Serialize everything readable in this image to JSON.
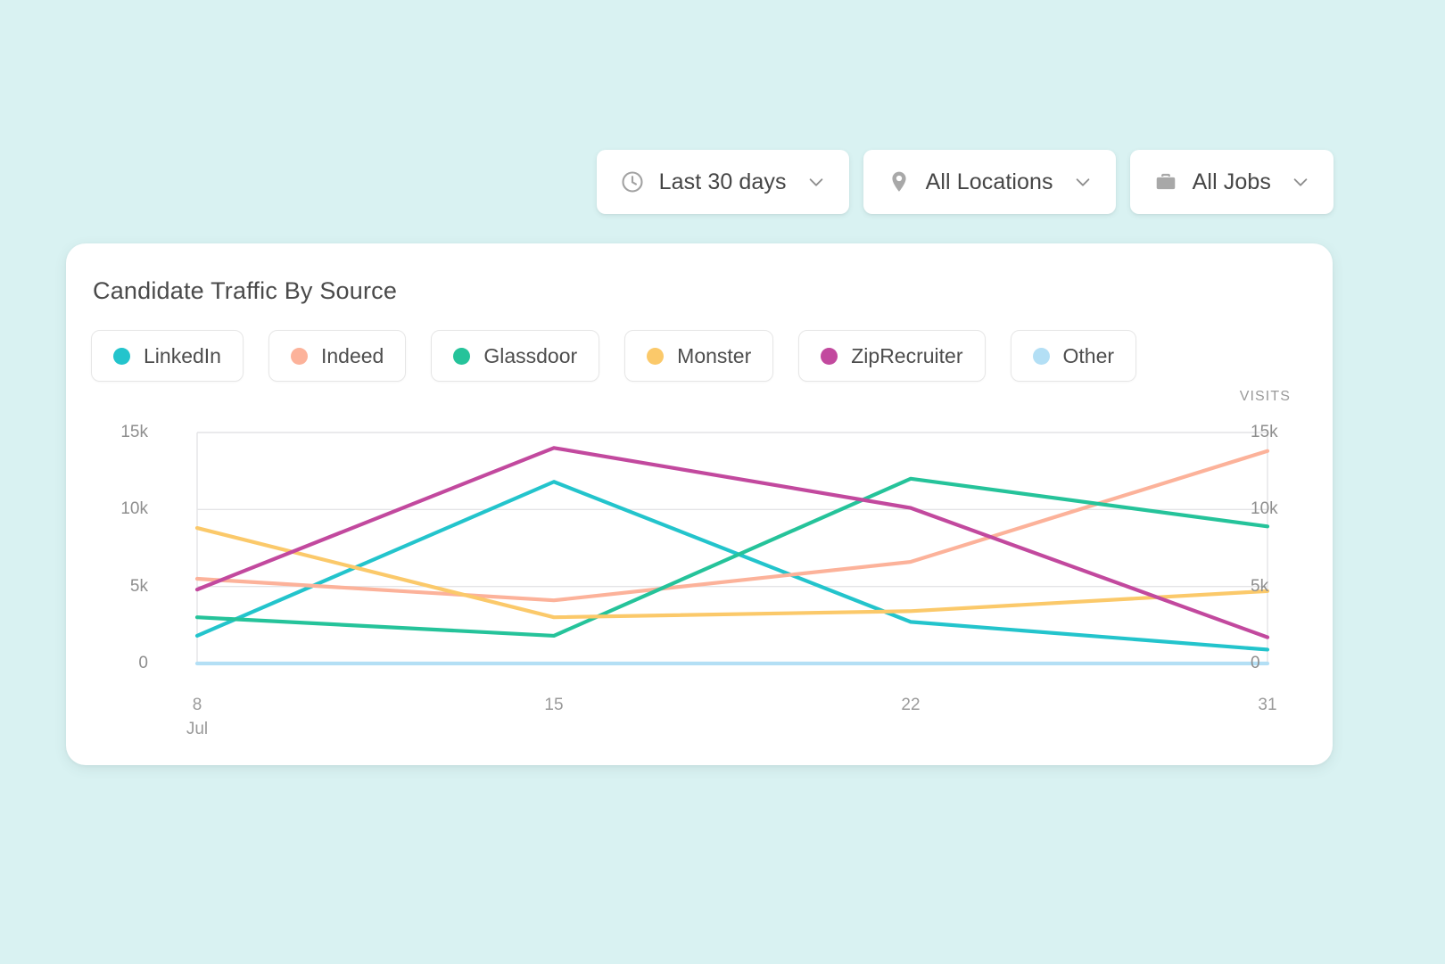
{
  "filters": [
    {
      "id": "date-range",
      "icon": "clock-icon",
      "label": "Last 30 days",
      "chevron": "chevron-down-icon"
    },
    {
      "id": "locations",
      "icon": "map-pin-icon",
      "label": "All Locations",
      "chevron": "chevron-down-icon"
    },
    {
      "id": "jobs",
      "icon": "briefcase-icon",
      "label": "All Jobs",
      "chevron": "chevron-down-icon"
    }
  ],
  "card": {
    "title": "Candidate Traffic By Source"
  },
  "chart_data": {
    "type": "line",
    "title": "Candidate Traffic By Source",
    "xlabel": "Jul",
    "ylabel": "VISITS",
    "ylim": [
      0,
      15000
    ],
    "y_ticks": [
      "0",
      "5k",
      "10k",
      "15k"
    ],
    "y_tick_values": [
      0,
      5000,
      10000,
      15000
    ],
    "x_ticks": [
      "8",
      "15",
      "22",
      "31"
    ],
    "x_tick_values": [
      8,
      15,
      22,
      31
    ],
    "month_label": "Jul",
    "grid": true,
    "legend_position": "top",
    "dual_axis": true,
    "x": [
      8,
      15,
      22,
      31
    ],
    "series": [
      {
        "name": "LinkedIn",
        "color": "#23c4cc",
        "values": [
          1800,
          11800,
          2700,
          900
        ]
      },
      {
        "name": "Indeed",
        "color": "#fcb29a",
        "values": [
          5500,
          4100,
          6600,
          13800
        ]
      },
      {
        "name": "Glassdoor",
        "color": "#25c39a",
        "values": [
          3000,
          1800,
          12000,
          8900
        ]
      },
      {
        "name": "Monster",
        "color": "#fbc96a",
        "values": [
          8800,
          3000,
          3400,
          4700
        ]
      },
      {
        "name": "ZipRecruiter",
        "color": "#c2499e",
        "values": [
          4800,
          14000,
          10100,
          1700
        ]
      },
      {
        "name": "Other",
        "color": "#b3dff5",
        "values": [
          0,
          0,
          0,
          0
        ]
      }
    ]
  },
  "colors": {
    "page_background": "#d9f2f2",
    "card_background": "#ffffff",
    "text_primary": "#4a4a4a",
    "text_muted": "#9a9a9a",
    "grid": "#e4e4e6"
  }
}
